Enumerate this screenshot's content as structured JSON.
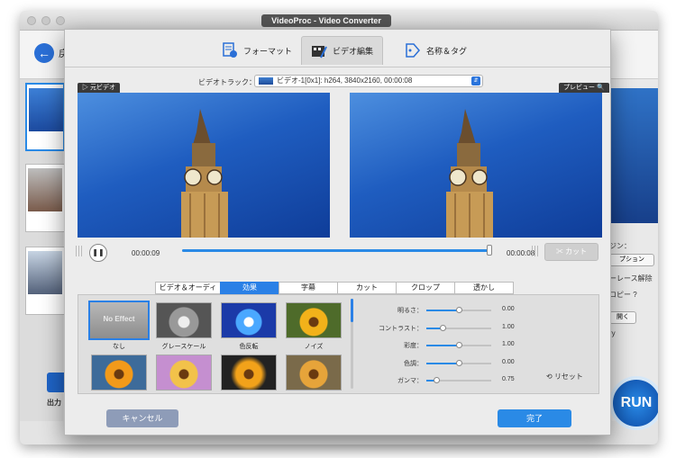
{
  "app": {
    "window_title": "VideoProc - Video Converter"
  },
  "background": {
    "back_label": "戻",
    "output_label": "出力",
    "run_label": "RUN",
    "right_texts": [
      "ジン：",
      "プション",
      "ーレース解除",
      "コピー ?",
      "開く",
      "ry"
    ]
  },
  "dialog": {
    "tabs": [
      {
        "label": "フォーマット",
        "icon": "format-icon"
      },
      {
        "label": "ビデオ編集",
        "icon": "video-edit-icon"
      },
      {
        "label": "名称＆タグ",
        "icon": "name-tag-icon"
      }
    ],
    "active_tab": "ビデオ編集",
    "track_label": "ビデオトラック：",
    "track_value": "ビデオ-1[0x1]: h264, 3840x2160, 00:00:08",
    "source_tag": "元ビデオ",
    "preview_tag": "プレビュー",
    "time_current": "00:00:09",
    "time_end": "00:00:08",
    "playback_progress": 0.99,
    "cut_label": "カット",
    "sub_tabs": [
      "ビデオ＆オーディオ",
      "効果",
      "字幕",
      "カット",
      "クロップ",
      "透かし"
    ],
    "active_sub_tab": "効果",
    "effects": [
      {
        "name": "なし",
        "thumb_text": "No Effect"
      },
      {
        "name": "グレースケール"
      },
      {
        "name": "色反転"
      },
      {
        "name": "ノイズ"
      },
      {
        "name": ""
      },
      {
        "name": ""
      },
      {
        "name": ""
      },
      {
        "name": ""
      }
    ],
    "adjustments": [
      {
        "label": "明るさ：",
        "value": "0.00",
        "level": 0.5
      },
      {
        "label": "コントラスト：",
        "value": "1.00",
        "level": 0.25
      },
      {
        "label": "彩度：",
        "value": "1.00",
        "level": 0.5
      },
      {
        "label": "色調：",
        "value": "0.00",
        "level": 0.5
      },
      {
        "label": "ガンマ：",
        "value": "0.75",
        "level": 0.15
      }
    ],
    "reset_label": "リセット",
    "cancel_label": "キャンセル",
    "done_label": "完了"
  },
  "colors": {
    "accent": "#2a80e6",
    "cancel": "#8e9cb8"
  }
}
